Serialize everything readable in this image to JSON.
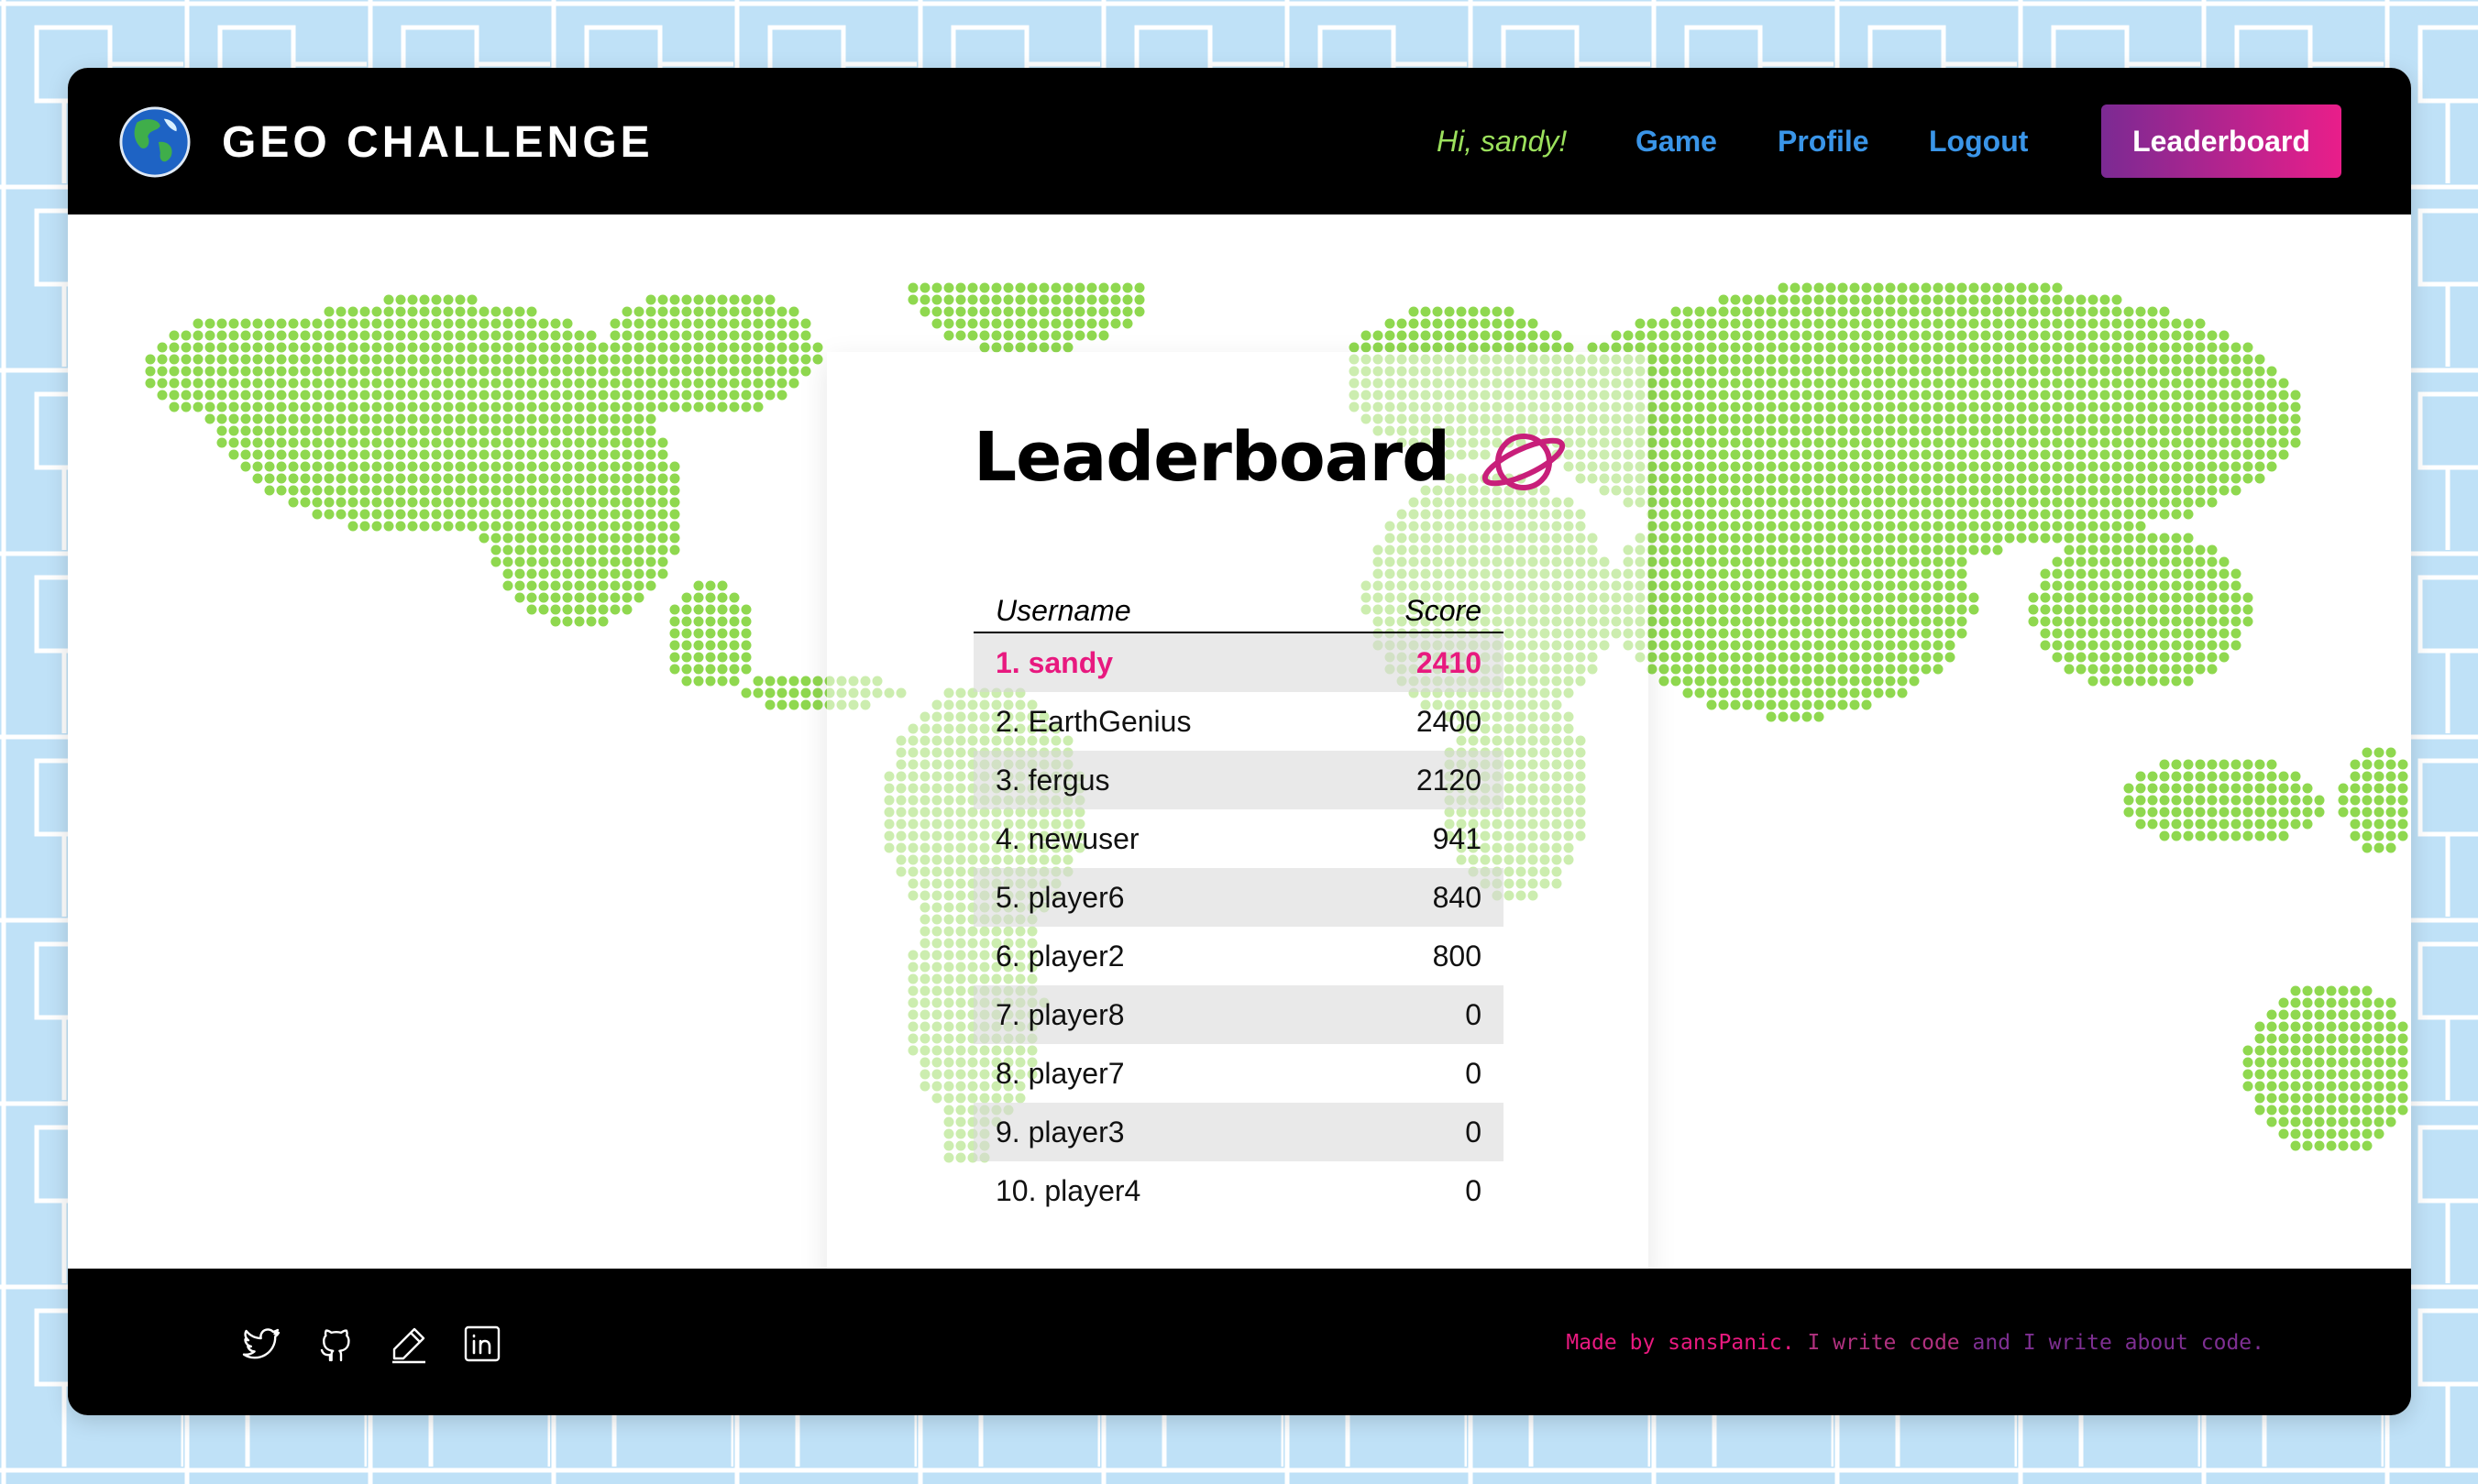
{
  "header": {
    "brand": "GEO CHALLENGE",
    "greeting": "Hi, sandy!",
    "nav": {
      "game": "Game",
      "profile": "Profile",
      "logout": "Logout",
      "leaderboard": "Leaderboard"
    }
  },
  "leaderboard": {
    "title": "Leaderboard",
    "columns": {
      "username": "Username",
      "score": "Score"
    },
    "rows": [
      {
        "user": "1. sandy",
        "score": "2410",
        "current": true
      },
      {
        "user": "2. EarthGenius",
        "score": "2400"
      },
      {
        "user": "3. fergus",
        "score": "2120"
      },
      {
        "user": "4. newuser",
        "score": "941"
      },
      {
        "user": "5. player6",
        "score": "840"
      },
      {
        "user": "6. player2",
        "score": "800"
      },
      {
        "user": "7. player8",
        "score": "0"
      },
      {
        "user": "8. player7",
        "score": "0"
      },
      {
        "user": "9. player3",
        "score": "0"
      },
      {
        "user": "10. player4",
        "score": "0"
      }
    ]
  },
  "footer": {
    "credit_a": "Made by sansPanic.",
    "credit_b": "I write code",
    "credit_c": "and I write about code.",
    "social": [
      "twitter-icon",
      "github-icon",
      "pencil-icon",
      "linkedin-icon"
    ]
  },
  "colors": {
    "accent": "#e8197f",
    "link": "#3a95e8",
    "greeting": "#9be05c",
    "map": "#8fd84f",
    "background": "#bfe1f7"
  }
}
